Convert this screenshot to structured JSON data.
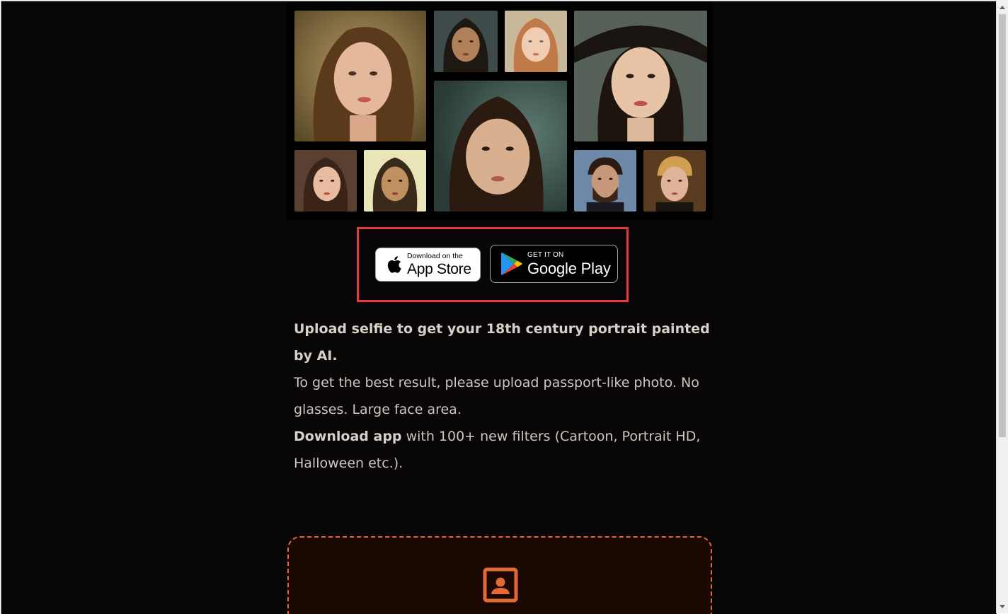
{
  "stores": {
    "app_store": {
      "small": "Download on the",
      "big": "App Store"
    },
    "google_play": {
      "small": "GET IT ON",
      "big": "Google Play"
    }
  },
  "description": {
    "headline": "Upload selfie to get your 18th century portrait painted by AI.",
    "tip": "To get the best result, please upload passport-like photo. No glasses. Large face area.",
    "download_bold": "Download app",
    "download_rest": " with 100+ new filters (Cartoon, Portrait HD, Halloween etc.)."
  },
  "colors": {
    "page_bg": "#080606",
    "highlight": "#e8393f",
    "upload_accent": "#e26a36",
    "upload_bg": "#1c0903"
  },
  "icons": {
    "upload": "portrait-upload-icon",
    "apple": "apple-logo-icon",
    "google_play": "google-play-logo-icon"
  }
}
